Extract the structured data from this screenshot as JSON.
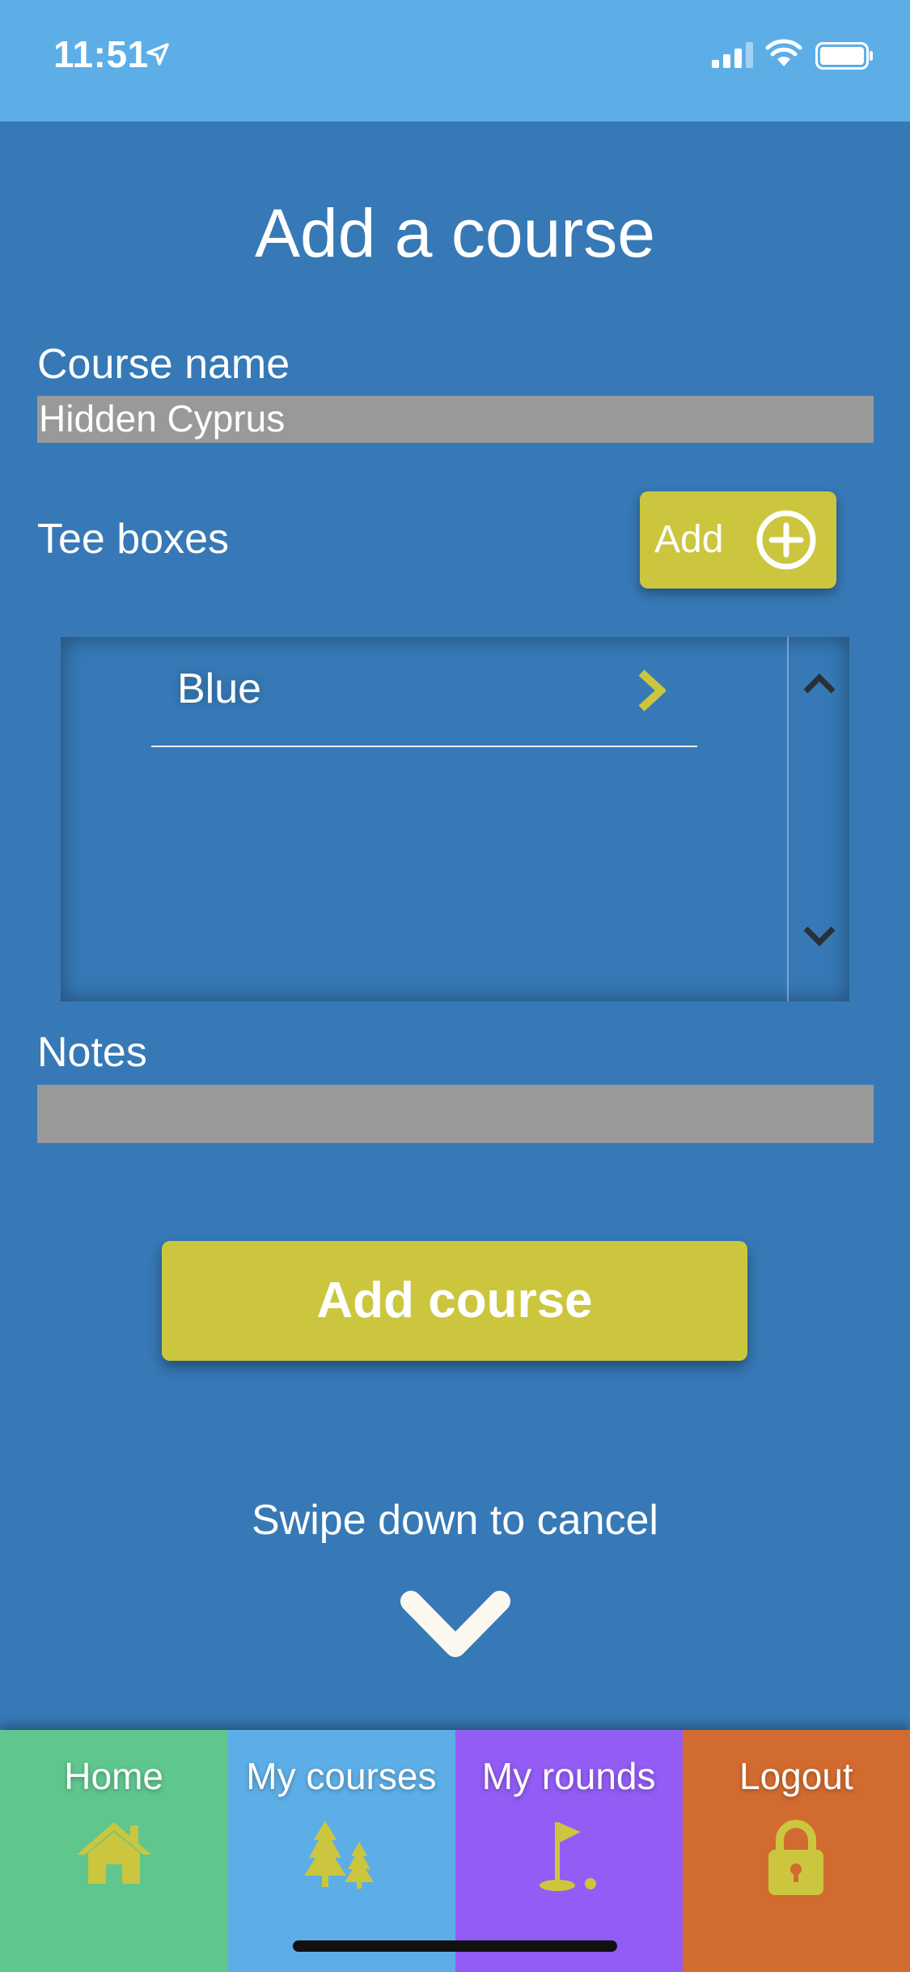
{
  "status_bar": {
    "time": "11:51",
    "background": "#5daee6"
  },
  "page": {
    "title": "Add a course",
    "background": "#3679b6"
  },
  "course_name": {
    "label": "Course name",
    "value": "Hidden Cyprus"
  },
  "tee_boxes": {
    "label": "Tee boxes",
    "add_label": "Add",
    "items": [
      {
        "label": "Blue"
      }
    ]
  },
  "notes": {
    "label": "Notes",
    "value": ""
  },
  "add_course_button": {
    "label": "Add course",
    "color": "#cbc63e"
  },
  "swipe_hint": "Swipe down to cancel",
  "nav": {
    "tabs": [
      {
        "label": "Home",
        "icon": "home-icon",
        "color": "#5fc68e"
      },
      {
        "label": "My courses",
        "icon": "trees-icon",
        "color": "#5daee6"
      },
      {
        "label": "My rounds",
        "icon": "golf-flag-icon",
        "color": "#925cf5"
      },
      {
        "label": "Logout",
        "icon": "lock-icon",
        "color": "#d26b2f"
      }
    ]
  },
  "accent_color": "#cbc63e"
}
